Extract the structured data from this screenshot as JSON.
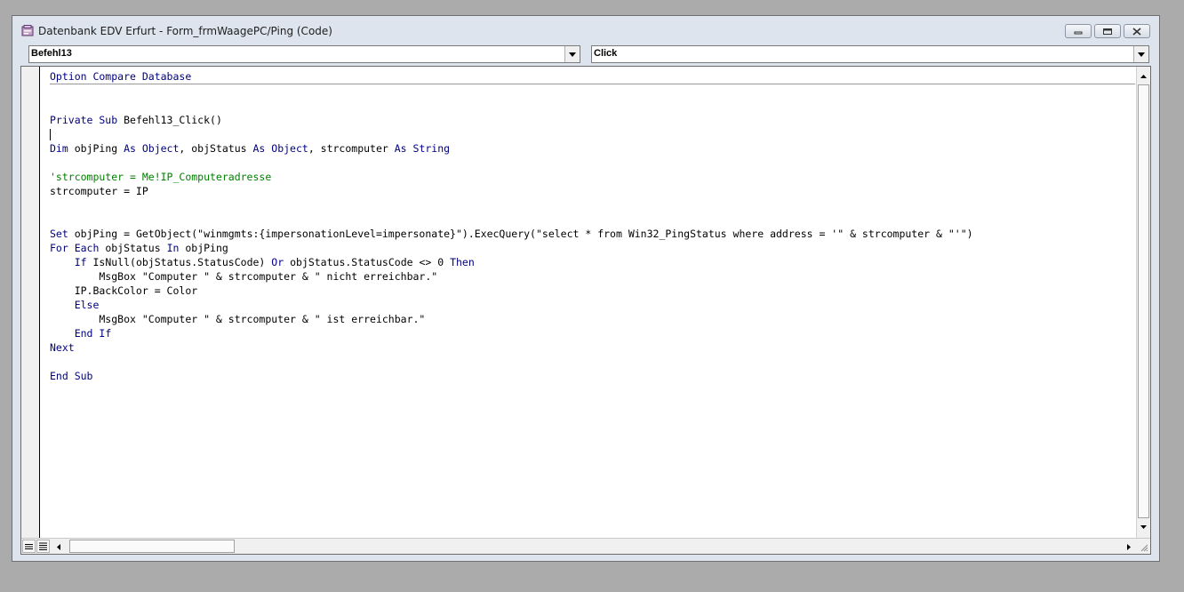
{
  "window": {
    "title": "Datenbank EDV Erfurt - Form_frmWaagePC/Ping (Code)"
  },
  "object_combo": {
    "value": "Befehl13"
  },
  "procedure_combo": {
    "value": "Click"
  },
  "code": {
    "lines": [
      [
        {
          "t": "Option Compare Database",
          "c": "kw"
        }
      ],
      [],
      [],
      [
        {
          "t": "Private Sub",
          "c": "kw"
        },
        {
          "t": " Befehl13_Click()"
        }
      ],
      [],
      [
        {
          "t": "Dim",
          "c": "kw"
        },
        {
          "t": " objPing "
        },
        {
          "t": "As Object",
          "c": "kw"
        },
        {
          "t": ", objStatus "
        },
        {
          "t": "As Object",
          "c": "kw"
        },
        {
          "t": ", strcomputer "
        },
        {
          "t": "As String",
          "c": "kw"
        }
      ],
      [],
      [
        {
          "t": "'strcomputer = Me!IP_Computeradresse",
          "c": "cm"
        }
      ],
      [
        {
          "t": "strcomputer = IP"
        }
      ],
      [],
      [],
      [
        {
          "t": "Set",
          "c": "kw"
        },
        {
          "t": " objPing = GetObject(\"winmgmts:{impersonationLevel=impersonate}\").ExecQuery(\"select * from Win32_PingStatus where address = '\" & strcomputer & \"'\")"
        }
      ],
      [
        {
          "t": "For Each",
          "c": "kw"
        },
        {
          "t": " objStatus "
        },
        {
          "t": "In",
          "c": "kw"
        },
        {
          "t": " objPing"
        }
      ],
      [
        {
          "t": "    "
        },
        {
          "t": "If",
          "c": "kw"
        },
        {
          "t": " IsNull(objStatus.StatusCode) "
        },
        {
          "t": "Or",
          "c": "kw"
        },
        {
          "t": " objStatus.StatusCode <> 0 "
        },
        {
          "t": "Then",
          "c": "kw"
        }
      ],
      [
        {
          "t": "        MsgBox \"Computer \" & strcomputer & \" nicht erreichbar.\""
        }
      ],
      [
        {
          "t": "    IP.BackColor = Color"
        }
      ],
      [
        {
          "t": "    "
        },
        {
          "t": "Else",
          "c": "kw"
        }
      ],
      [
        {
          "t": "        MsgBox \"Computer \" & strcomputer & \" ist erreichbar.\""
        }
      ],
      [
        {
          "t": "    "
        },
        {
          "t": "End If",
          "c": "kw"
        }
      ],
      [
        {
          "t": "Next",
          "c": "kw"
        }
      ],
      [],
      [
        {
          "t": "End Sub",
          "c": "kw"
        }
      ]
    ]
  },
  "icons": {
    "app": "access-form-icon",
    "minimize": "minimize-icon",
    "maximize": "maximize-icon",
    "close": "close-icon",
    "dropdown": "chevron-down-icon",
    "procedure_view": "procedure-view-icon",
    "module_view": "full-module-view-icon"
  },
  "colors": {
    "keyword": "#00007f",
    "comment": "#007f00",
    "frame": "#dde4ee",
    "desktop": "#ababab"
  }
}
